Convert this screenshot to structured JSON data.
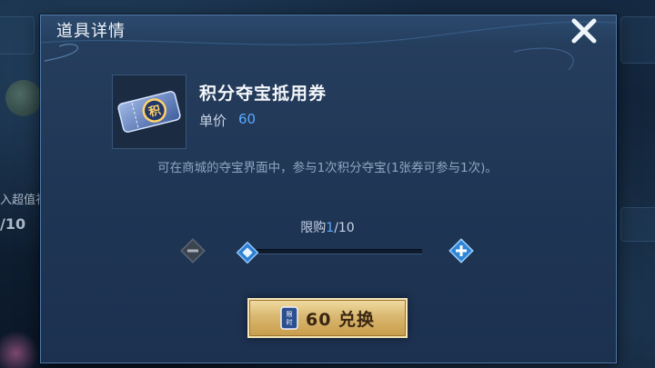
{
  "background": {
    "left_label": "入超值礼",
    "left_counter": "/10"
  },
  "dialog": {
    "title": "道具详情",
    "close_icon": "close-icon"
  },
  "item": {
    "name": "积分夺宝抵用券",
    "price_label": "单价",
    "price_value": "60",
    "description": "可在商城的夺宝界面中，参与1次积分夺宝(1张券可参与1次)。",
    "icon": "points-ticket-icon",
    "icon_glyph": "积"
  },
  "quantity": {
    "limit_label": "限购",
    "current": "1",
    "max": "/10",
    "level": 0.1
  },
  "exchange_button": {
    "label": "60 兑换",
    "icon_glyph": "限时"
  },
  "colors": {
    "accent_blue": "#5aa8ff",
    "gold_button": "#d9b870",
    "dialog_bg": "#1f3554"
  }
}
